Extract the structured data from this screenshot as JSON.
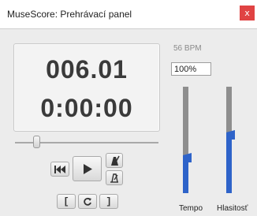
{
  "window": {
    "title": "MuseScore: Prehrávací panel",
    "close_glyph": "x"
  },
  "display": {
    "measure": "006.01",
    "time": "0:00:00"
  },
  "position_slider": {
    "value": 0.15
  },
  "transport": {
    "rewind": "rewind-to-start-icon",
    "play": "play-icon",
    "metronome": "metronome-icon",
    "countin": "count-in-icon",
    "loop_in": "[",
    "loop": "loop-icon",
    "loop_out": "]"
  },
  "tempo": {
    "bpm_label": "56 BPM",
    "value": "100%",
    "slider_label": "Tempo",
    "slider_value": 0.33
  },
  "volume": {
    "slider_label": "Hlasitosť",
    "slider_value": 0.55
  },
  "colors": {
    "accent": "#2e63c9",
    "track_gray": "#8e8e8e",
    "close": "#e04343"
  }
}
